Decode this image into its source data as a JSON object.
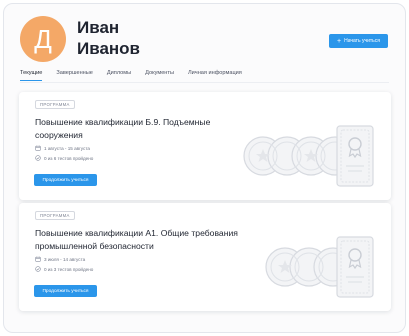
{
  "profile": {
    "avatar_letter": "Д",
    "first_name": "Иван",
    "last_name": "Иванов",
    "avatar_color": "#f4a867"
  },
  "header": {
    "start_button_icon": "+",
    "start_button_label": "Начать учиться",
    "accent_color": "#2b96ea"
  },
  "tabs": [
    {
      "label": "Текущие",
      "active": true
    },
    {
      "label": "Завершенные"
    },
    {
      "label": "Дипломы"
    },
    {
      "label": "Документы"
    },
    {
      "label": "Личная информация"
    }
  ],
  "courses": [
    {
      "badge": "ПРОГРАММА",
      "title": "Повышение квалификации Б.9. Подъемные сооружения",
      "dates": "1 августа - 15 августа",
      "tests": "0 из 6 тестов пройдено",
      "button": "Продолжить учиться"
    },
    {
      "badge": "ПРОГРАММА",
      "title": "Повышение квалификации А1. Общие требования промышленной безопасности",
      "dates": "3 июля - 14 августа",
      "tests": "0 из 3 тестов пройдено",
      "button": "Продолжить учиться"
    }
  ]
}
